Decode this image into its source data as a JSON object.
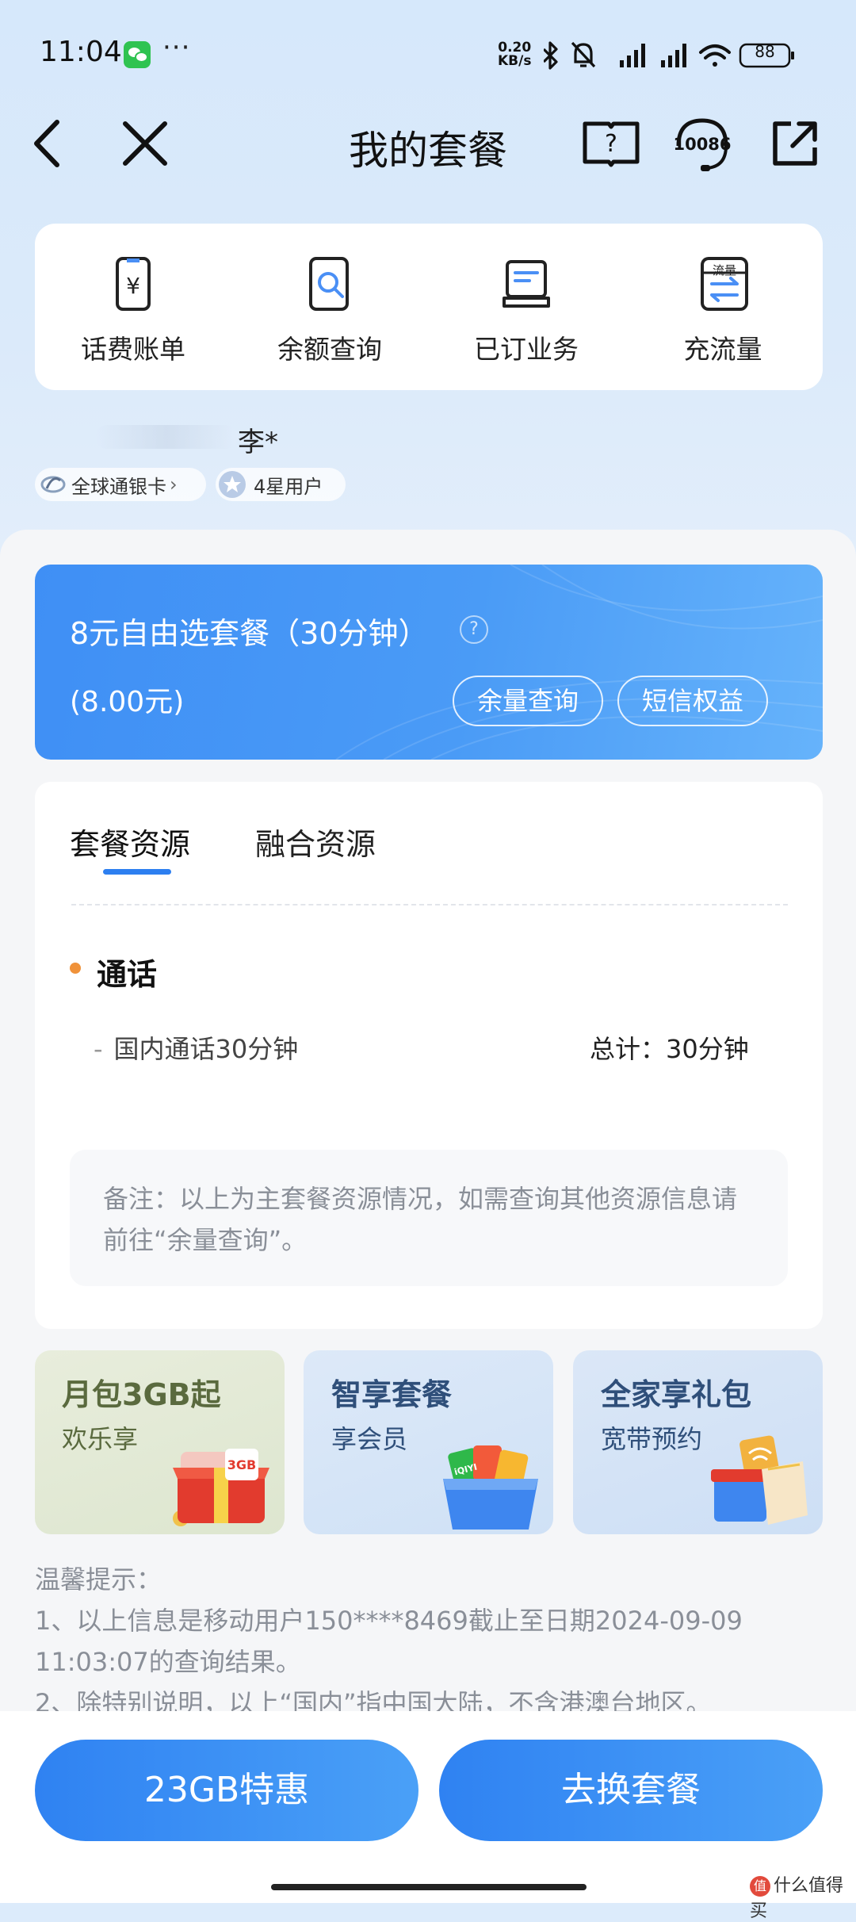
{
  "status_bar": {
    "time": "11:04",
    "dots": "···",
    "net_speed_value": "0.20",
    "net_speed_unit": "KB/s",
    "battery": "88"
  },
  "header": {
    "title": "我的套餐",
    "service_label": "10086"
  },
  "quick_menu": [
    {
      "label": "话费账单",
      "icon": "bill-icon"
    },
    {
      "label": "余额查询",
      "icon": "balance-search-icon"
    },
    {
      "label": "已订业务",
      "icon": "subscribed-icon"
    },
    {
      "label": "充流量",
      "icon": "data-recharge-icon"
    }
  ],
  "quick_menu_badge": "流量",
  "user": {
    "name": "李*",
    "card_type": "全球通银卡",
    "level": "4星用户"
  },
  "plan": {
    "name": "8元自由选套餐（30分钟）",
    "price": "(8.00元)",
    "help": "?",
    "btn_balance": "余量查询",
    "btn_sms": "短信权益"
  },
  "resources": {
    "tab_plan": "套餐资源",
    "tab_fusion": "融合资源",
    "section_title": "通话",
    "line_prefix": "-",
    "line_item": "国内通话30分钟",
    "line_total": "总计：30分钟",
    "note": "备注：以上为主套餐资源情况，如需查询其他资源信息请前往“余量查询”。"
  },
  "promos": [
    {
      "title": "月包3GB起",
      "subtitle": "欢乐享",
      "tag": "3GB"
    },
    {
      "title": "智享套餐",
      "subtitle": "享会员",
      "tag": "iQIYI"
    },
    {
      "title": "全家享礼包",
      "subtitle": "宽带预约",
      "tag": ""
    }
  ],
  "tips": {
    "heading": "温馨提示：",
    "line1": "1、以上信息是移动用户150****8469截止至日期2024-09-09 11:03:07的查询结果。",
    "line2": "2、除特别说明，以上“国内”指中国大陆，不含港澳台地区。"
  },
  "bottom": {
    "btn_left": "23GB特惠",
    "btn_right": "去换套餐"
  },
  "watermark": "什么值得买",
  "watermark_logo": "值",
  "colors": {
    "accent": "#2f82f2",
    "orange_dot": "#f0923a",
    "promo1_title": "#5a6a3e",
    "promo2_title": "#2f4f7a"
  }
}
